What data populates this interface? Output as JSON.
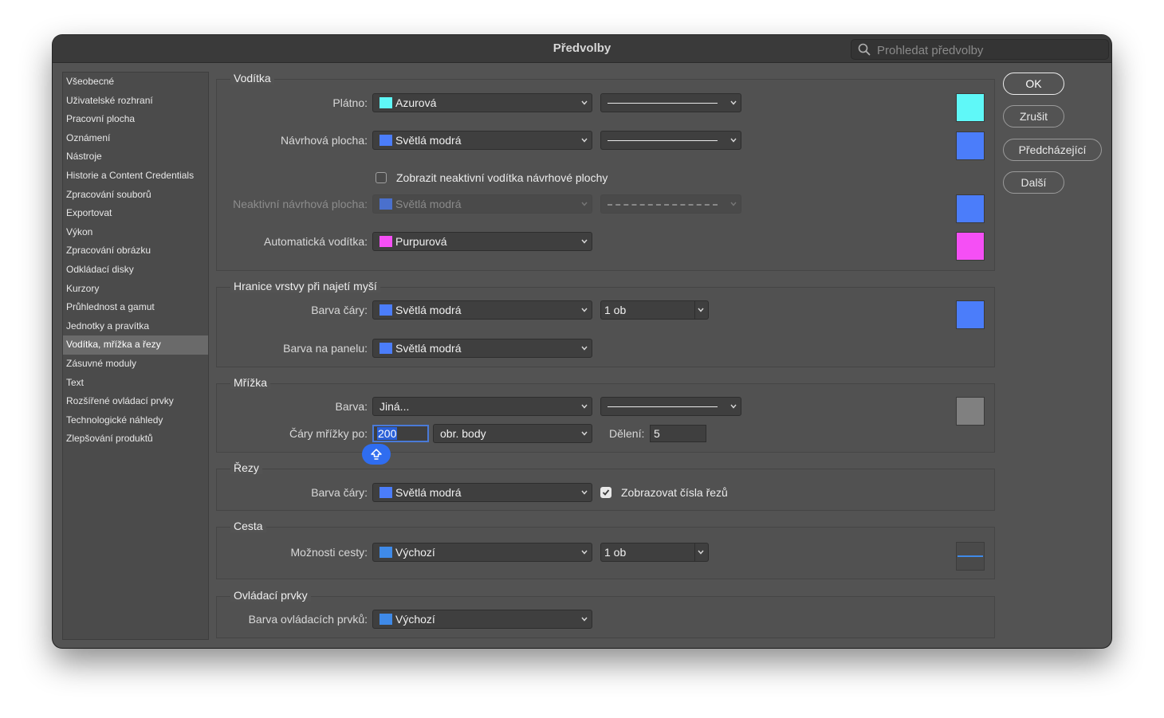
{
  "window": {
    "title": "Předvolby"
  },
  "search": {
    "placeholder": "Prohledat předvolby",
    "icon": "search-icon"
  },
  "sidebar": {
    "items": [
      {
        "label": "Všeobecné"
      },
      {
        "label": "Uživatelské rozhraní"
      },
      {
        "label": "Pracovní plocha"
      },
      {
        "label": "Oznámení"
      },
      {
        "label": "Nástroje"
      },
      {
        "label": "Historie a Content Credentials"
      },
      {
        "label": "Zpracování souborů"
      },
      {
        "label": "Exportovat"
      },
      {
        "label": "Výkon"
      },
      {
        "label": "Zpracování obrázku"
      },
      {
        "label": "Odkládací disky"
      },
      {
        "label": "Kurzory"
      },
      {
        "label": "Průhlednost a gamut"
      },
      {
        "label": "Jednotky a pravítka"
      },
      {
        "label": "Vodítka, mřížka a řezy",
        "active": true
      },
      {
        "label": "Zásuvné moduly"
      },
      {
        "label": "Text"
      },
      {
        "label": "Rozšířené ovládací prvky"
      },
      {
        "label": "Technologické náhledy"
      },
      {
        "label": "Zlepšování produktů"
      }
    ]
  },
  "buttons": {
    "ok": "OK",
    "cancel": "Zrušit",
    "prev": "Předcházející",
    "next": "Další"
  },
  "colors": {
    "cyan": "#5ff8f8",
    "light_blue": "#4b7dfa",
    "magenta": "#f54ff5",
    "gray": "#808080",
    "default_blue": "#3f8ae8"
  },
  "guides": {
    "heading": "Vodítka",
    "canvas_label": "Plátno:",
    "canvas_color": "Azurová",
    "artboard_label": "Návrhová plocha:",
    "artboard_color": "Světlá modrá",
    "show_inactive_label": "Zobrazit neaktivní vodítka návrhové plochy",
    "show_inactive_checked": false,
    "inactive_label": "Neaktivní návrhová plocha:",
    "inactive_color": "Světlá modrá",
    "smart_label": "Automatická vodítka:",
    "smart_color": "Purpurová"
  },
  "hover": {
    "heading": "Hranice vrstvy při najetí myší",
    "line_label": "Barva čáry:",
    "line_color": "Světlá modrá",
    "width": "1 ob",
    "panel_label": "Barva na panelu:",
    "panel_color": "Světlá modrá"
  },
  "grid": {
    "heading": "Mřížka",
    "color_label": "Barva:",
    "color_value": "Jiná...",
    "every_label": "Čáry mřížky po:",
    "every_value": "200",
    "unit_value": "obr. body",
    "subdiv_label": "Dělení:",
    "subdiv_value": "5"
  },
  "slices": {
    "heading": "Řezy",
    "line_label": "Barva čáry:",
    "line_color": "Světlá modrá",
    "show_numbers_label": "Zobrazovat čísla řezů",
    "show_numbers_checked": true
  },
  "path": {
    "heading": "Cesta",
    "options_label": "Možnosti cesty:",
    "options_value": "Výchozí",
    "width": "1 ob"
  },
  "controls": {
    "heading": "Ovládací prvky",
    "color_label": "Barva ovládacích prvků:",
    "color_value": "Výchozí"
  }
}
